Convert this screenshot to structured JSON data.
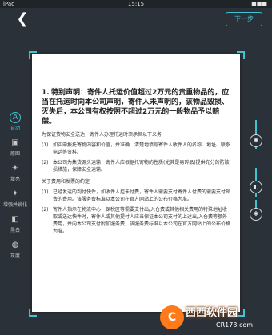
{
  "status_bar": {
    "device": "iPad",
    "time": "15:15",
    "battery": "■■■"
  },
  "header": {
    "back_icon": "chevron-left-icon",
    "next_label": "下一步"
  },
  "sidebar": {
    "items": [
      {
        "label": "自动",
        "icon": "auto-a-icon",
        "active": true
      },
      {
        "label": "原图",
        "icon": "image-icon",
        "active": false
      },
      {
        "label": "增亮",
        "icon": "bulb-icon",
        "active": false
      },
      {
        "label": "增强并锐化",
        "icon": "sparkle-icon",
        "active": false
      },
      {
        "label": "黑白",
        "icon": "bw-icon",
        "active": false
      },
      {
        "label": "灰度",
        "icon": "gray-icon",
        "active": false
      }
    ]
  },
  "document": {
    "heading_num": "1.",
    "heading": "特别声明：寄件人托运价值超过2万元的贵重物品的，应当在托运时向本公司声明，寄件人未声明的，该物品毁损、灭失后，本公司有权按照不超过2万元的一般物品予以赔偿。",
    "intro": "为保证货物安全送达，寄件人办理托运时须承担以下义务",
    "items": [
      {
        "mark": "(1)",
        "text": "如实申报托寄物内容和价值，并准确、清楚地填写寄件人收件人的名称、地址、联系电话等资料。"
      },
      {
        "mark": "(2)",
        "text": "本公司为集货源头运输，寄件人应根据托寄物的性质(尤其是易碎品)提供充分的防破损措施，保障安全运输。"
      }
    ],
    "section2": "关于费用和发票的约定",
    "items2": [
      {
        "mark": "(1)",
        "text": "已经发运的到付快件，如收件人拒未付费，寄件人需要支付寄件人付费的需要支付邮费的费用。该服务费标准以本公司在官方网站上的公布价格为准。"
      },
      {
        "mark": "(2)",
        "text": "寄件人指示在物流中心，保税区等需要支付出/入仓费或其他相关费用的特殊地址收取或送达快件时，寄件人或其他提付人应当保证本公司支付的上述出/入仓费等额外费用，并向本公司支付附加服务费，该服务费标准以本公司在官方网站上的公布价格为准。"
      }
    ]
  },
  "right_controls": [
    {
      "icon": "brightness-icon",
      "symbol": "✺"
    },
    {
      "icon": "contrast-icon",
      "symbol": "◐"
    },
    {
      "icon": "detail-icon",
      "symbol": "✱"
    }
  ],
  "watermark": {
    "logo_char": "C",
    "text": "西西软件园",
    "sub": "CR173.com"
  },
  "colors": {
    "accent": "#3fc3d2",
    "background": "#2b3138"
  }
}
